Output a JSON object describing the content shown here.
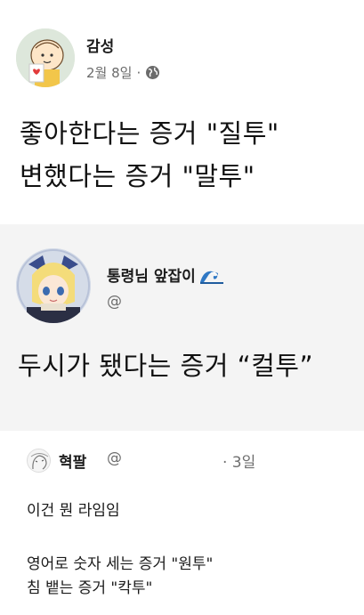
{
  "post": {
    "author": "감성",
    "date": "2월 8일",
    "separator": "·",
    "visibility_icon": "globe-icon",
    "lines": [
      "좋아한다는 증거 \"질투\"",
      "변했다는 증거 \"말투\""
    ]
  },
  "quoted_post": {
    "author": "통령님 앞잡이",
    "author_emoji_icon": "wave-icon",
    "handle": "@",
    "text": "두시가 됐다는 증거 “컬투”"
  },
  "comment": {
    "author": "혁팔",
    "handle": "@",
    "time": "· 3일",
    "lines": [
      "이건 뭔 라임임",
      "영어로 숫자 세는 증거 \"원투\"",
      "침 뱉는 증거 \"칵투\""
    ]
  },
  "colors": {
    "background": "#ffffff",
    "quote_background": "#f4f4f4",
    "secondary_text": "#6e6e6e"
  }
}
